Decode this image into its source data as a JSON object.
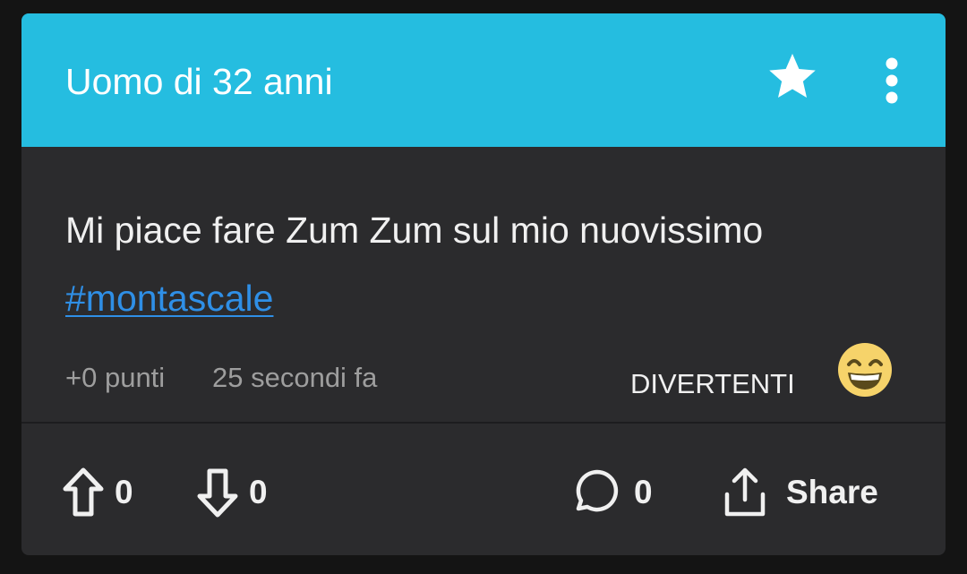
{
  "header": {
    "title": "Uomo di 32 anni",
    "background_color": "#25bde0",
    "favorite_icon": "star-icon",
    "menu_icon": "more-vertical-icon"
  },
  "post": {
    "text_before": "Mi piace fare Zum Zum sul mio nuovissimo ",
    "hashtag": "#montascale",
    "hashtag_color": "#2f8fe6",
    "points": "+0 punti",
    "time_ago": "25 secondi fa",
    "category": "DIVERTENTI",
    "category_icon": "grinning-face-emoji"
  },
  "actions": {
    "upvote_count": "0",
    "downvote_count": "0",
    "comment_count": "0",
    "share_label": "Share",
    "upvote_icon": "arrow-up-icon",
    "downvote_icon": "arrow-down-icon",
    "comment_icon": "comment-bubble-icon",
    "share_icon": "share-icon"
  }
}
